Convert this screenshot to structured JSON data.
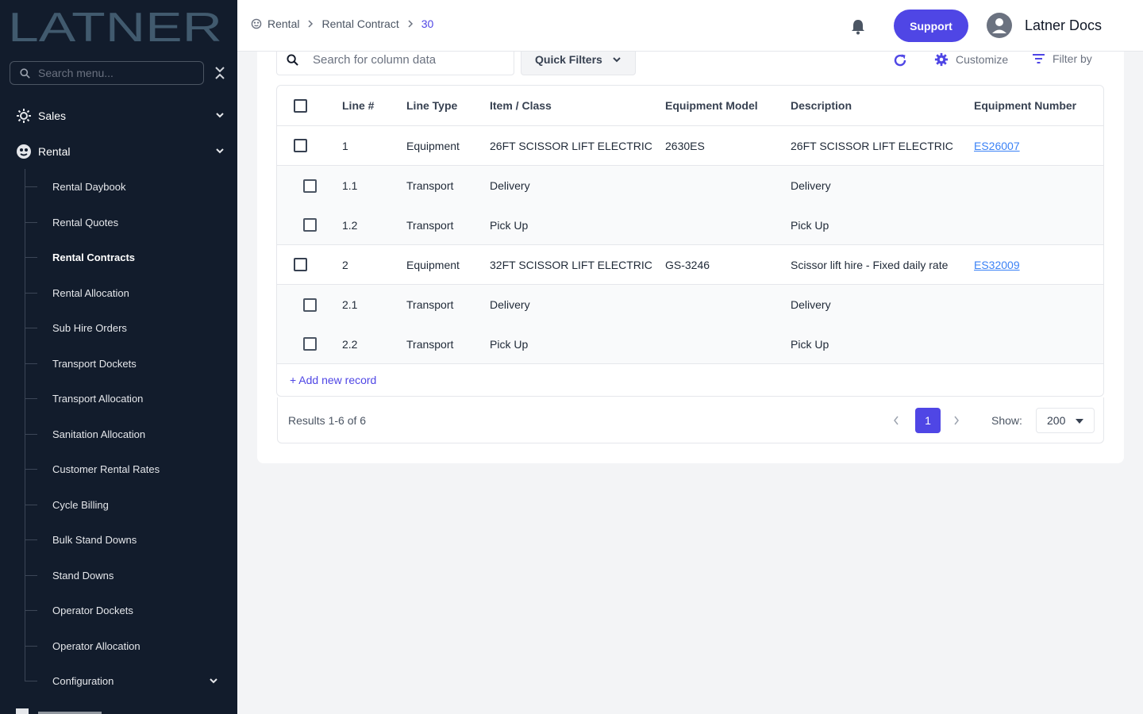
{
  "brand": {
    "logo_text": "LATNER",
    "logo_color": "#415a6e"
  },
  "sidebar": {
    "search_placeholder": "Search menu...",
    "nav": [
      {
        "label": "Sales",
        "icon": "sales-icon",
        "expanded": false
      },
      {
        "label": "Rental",
        "icon": "rental-icon",
        "expanded": true
      }
    ],
    "rental_items": [
      {
        "label": "Rental Daybook"
      },
      {
        "label": "Rental Quotes"
      },
      {
        "label": "Rental Contracts",
        "active": true
      },
      {
        "label": "Rental Allocation"
      },
      {
        "label": "Sub Hire Orders"
      },
      {
        "label": "Transport Dockets"
      },
      {
        "label": "Transport Allocation"
      },
      {
        "label": "Sanitation Allocation"
      },
      {
        "label": "Customer Rental Rates"
      },
      {
        "label": "Cycle Billing"
      },
      {
        "label": "Bulk Stand Downs"
      },
      {
        "label": "Stand Downs"
      },
      {
        "label": "Operator Dockets"
      },
      {
        "label": "Operator Allocation"
      },
      {
        "label": "Configuration",
        "has_children": true
      }
    ]
  },
  "header": {
    "breadcrumb": [
      "Rental",
      "Rental Contract",
      "30"
    ],
    "support_label": "Support",
    "user_name": "Latner Docs"
  },
  "toolbar": {
    "search_placeholder": "Search for column data",
    "quick_filters_label": "Quick Filters",
    "customize_label": "Customize",
    "filter_label": "Filter by"
  },
  "table": {
    "columns": [
      "Line #",
      "Line Type",
      "Item / Class",
      "Equipment Model",
      "Description",
      "Equipment Number"
    ],
    "rows": [
      {
        "line": "1",
        "type": "Equipment",
        "item": "26FT SCISSOR LIFT ELECTRIC",
        "model": "2630ES",
        "desc": "26FT SCISSOR LIFT ELECTRIC",
        "equip": "ES26007",
        "level": 0
      },
      {
        "line": "1.1",
        "type": "Transport",
        "item": "Delivery",
        "model": "",
        "desc": "Delivery",
        "equip": "",
        "level": 1
      },
      {
        "line": "1.2",
        "type": "Transport",
        "item": "Pick Up",
        "model": "",
        "desc": "Pick Up",
        "equip": "",
        "level": 1
      },
      {
        "line": "2",
        "type": "Equipment",
        "item": "32FT SCISSOR LIFT ELECTRIC",
        "model": "GS-3246",
        "desc": "Scissor lift hire - Fixed daily rate",
        "equip": "ES32009",
        "level": 0
      },
      {
        "line": "2.1",
        "type": "Transport",
        "item": "Delivery",
        "model": "",
        "desc": "Delivery",
        "equip": "",
        "level": 1
      },
      {
        "line": "2.2",
        "type": "Transport",
        "item": "Pick Up",
        "model": "",
        "desc": "Pick Up",
        "equip": "",
        "level": 1
      }
    ],
    "add_label": "+ Add new record"
  },
  "pagination": {
    "results_text": "Results 1-6 of 6",
    "current_page": "1",
    "show_label": "Show:",
    "page_size": "200"
  },
  "colors": {
    "accent": "#4f46e5",
    "sidebar_bg": "#121c2c",
    "link": "#3b82f6"
  }
}
